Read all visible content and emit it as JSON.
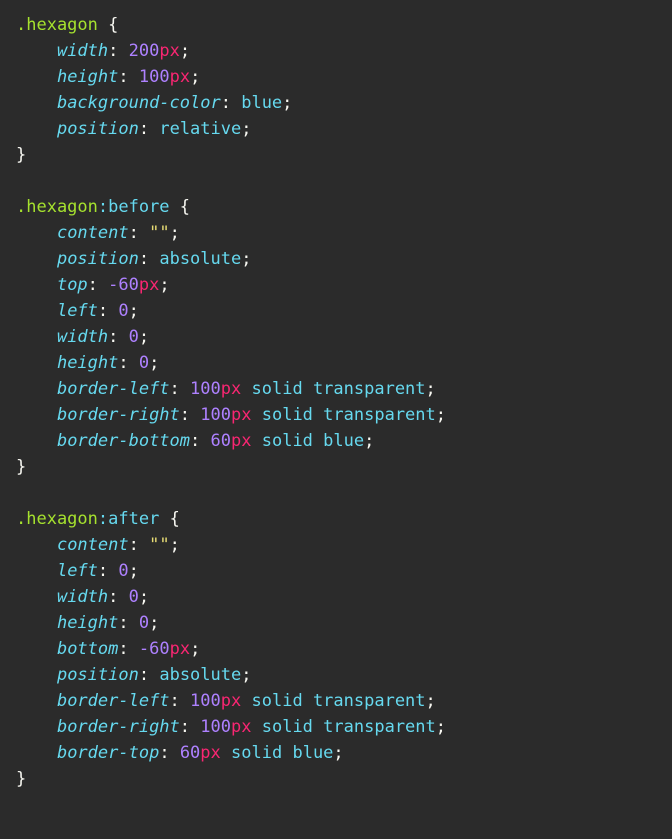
{
  "rules": [
    {
      "selector": ".hexagon",
      "pseudo": "",
      "decls": [
        {
          "prop": "width",
          "value": [
            {
              "num": "200",
              "unit": "px"
            }
          ]
        },
        {
          "prop": "height",
          "value": [
            {
              "num": "100",
              "unit": "px"
            }
          ]
        },
        {
          "prop": "background-color",
          "value": [
            {
              "kw": "blue"
            }
          ]
        },
        {
          "prop": "position",
          "value": [
            {
              "kw": "relative"
            }
          ]
        }
      ]
    },
    {
      "selector": ".hexagon",
      "pseudo": ":before",
      "decls": [
        {
          "prop": "content",
          "value": [
            {
              "str": "\"\""
            }
          ]
        },
        {
          "prop": "position",
          "value": [
            {
              "kw": "absolute"
            }
          ]
        },
        {
          "prop": "top",
          "value": [
            {
              "num": "-60",
              "unit": "px"
            }
          ]
        },
        {
          "prop": "left",
          "value": [
            {
              "num": "0"
            }
          ]
        },
        {
          "prop": "width",
          "value": [
            {
              "num": "0"
            }
          ]
        },
        {
          "prop": "height",
          "value": [
            {
              "num": "0"
            }
          ]
        },
        {
          "prop": "border-left",
          "value": [
            {
              "num": "100",
              "unit": "px"
            },
            {
              "kw": "solid"
            },
            {
              "kw": "transparent"
            }
          ]
        },
        {
          "prop": "border-right",
          "value": [
            {
              "num": "100",
              "unit": "px"
            },
            {
              "kw": "solid"
            },
            {
              "kw": "transparent"
            }
          ]
        },
        {
          "prop": "border-bottom",
          "value": [
            {
              "num": "60",
              "unit": "px"
            },
            {
              "kw": "solid"
            },
            {
              "kw": "blue"
            }
          ]
        }
      ]
    },
    {
      "selector": ".hexagon",
      "pseudo": ":after",
      "decls": [
        {
          "prop": "content",
          "value": [
            {
              "str": "\"\""
            }
          ]
        },
        {
          "prop": "left",
          "value": [
            {
              "num": "0"
            }
          ]
        },
        {
          "prop": "width",
          "value": [
            {
              "num": "0"
            }
          ]
        },
        {
          "prop": "height",
          "value": [
            {
              "num": "0"
            }
          ]
        },
        {
          "prop": "bottom",
          "value": [
            {
              "num": "-60",
              "unit": "px"
            }
          ]
        },
        {
          "prop": "position",
          "value": [
            {
              "kw": "absolute"
            }
          ]
        },
        {
          "prop": "border-left",
          "value": [
            {
              "num": "100",
              "unit": "px"
            },
            {
              "kw": "solid"
            },
            {
              "kw": "transparent"
            }
          ]
        },
        {
          "prop": "border-right",
          "value": [
            {
              "num": "100",
              "unit": "px"
            },
            {
              "kw": "solid"
            },
            {
              "kw": "transparent"
            }
          ]
        },
        {
          "prop": "border-top",
          "value": [
            {
              "num": "60",
              "unit": "px"
            },
            {
              "kw": "solid"
            },
            {
              "kw": "blue"
            }
          ]
        }
      ]
    }
  ]
}
